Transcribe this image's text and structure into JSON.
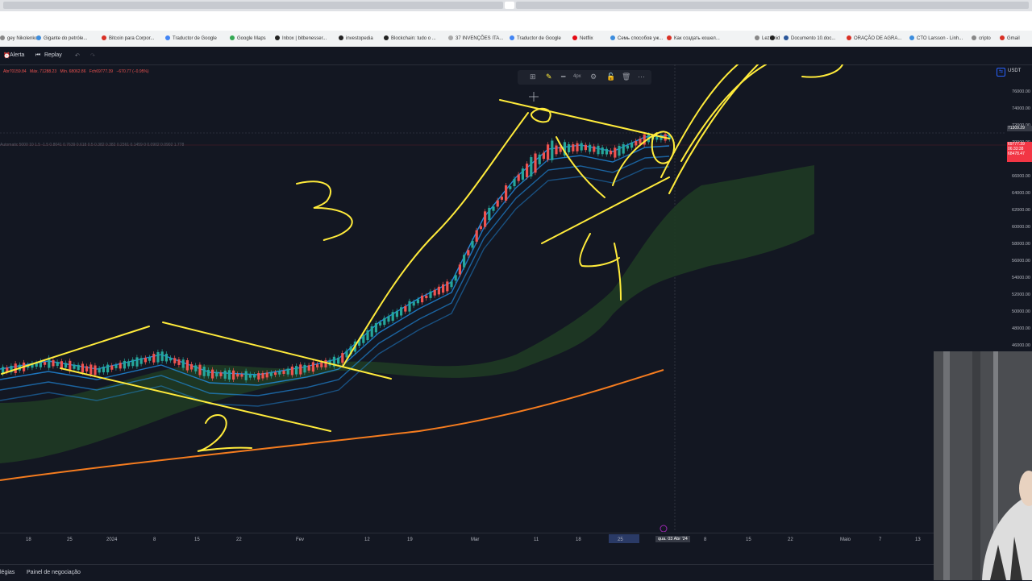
{
  "browser": {
    "bookmarks": [
      {
        "label": "gey Nikolenko",
        "color": "#888"
      },
      {
        "label": "Gigante do petróle...",
        "color": "#3c8dde"
      },
      {
        "label": "Bitcoin para Corpor...",
        "color": "#d93025"
      },
      {
        "label": "Traductor de Google",
        "color": "#4285f4"
      },
      {
        "label": "Google Maps",
        "color": "#34a853"
      },
      {
        "label": "Inbox | bitbenesser...",
        "color": "#222"
      },
      {
        "label": "investopedia",
        "color": "#222"
      },
      {
        "label": "Blockchain: tudo o ...",
        "color": "#222"
      },
      {
        "label": "37 INVENÇÕES ITA...",
        "color": "#aaa"
      },
      {
        "label": "Traductor de Google",
        "color": "#4285f4"
      },
      {
        "label": "Netflix",
        "color": "#e50914"
      },
      {
        "label": "Семь способов уж...",
        "color": "#3c8dde"
      },
      {
        "label": "Как создать кошел...",
        "color": "#d93025"
      },
      {
        "label": "Lezioni",
        "color": "#888"
      },
      {
        "label": "d",
        "color": "#222"
      },
      {
        "label": "Documento 10.doc...",
        "color": "#2b579a"
      },
      {
        "label": "ORAÇÃO DE AGRA...",
        "color": "#d93025"
      },
      {
        "label": "CTO Larsson - Linh...",
        "color": "#3c8dde"
      },
      {
        "label": "cripto",
        "color": "#888"
      },
      {
        "label": "Gmail",
        "color": "#d93025"
      }
    ]
  },
  "toolbar": {
    "alert_label": "Alerta",
    "replay_label": "Replay",
    "undo_icon": "undo-icon",
    "redo_icon": "redo-icon"
  },
  "legend": {
    "open": "Abr70159.84",
    "high": "Máx. 71288.23",
    "low": "Mín. 68062.86",
    "close": "Fch69777.39",
    "change": "−670.77 (−0.95%)",
    "fib_text": "Automatic 5000 10 1.5 -1.5 0.8041 0.7639 0.618 0.5 0.382 0.382 0.2361 0.1459 0 0.0902 0.0902 1.778"
  },
  "drawing_toolbar": {
    "items": [
      "template-icon",
      "pencil-icon",
      "line-style-icon",
      "settings-icon",
      "lock-icon",
      "trash-icon",
      "more-icon"
    ],
    "width_label": "4px"
  },
  "price_axis": {
    "currency": "USDT",
    "labels": [
      "76000.00",
      "74000.00",
      "72000.00",
      "70000.00",
      "68000.00",
      "66000.00",
      "64000.00",
      "62000.00",
      "60000.00",
      "58000.00",
      "56000.00",
      "54000.00",
      "52000.00",
      "50000.00",
      "48000.00",
      "46000.00"
    ],
    "crosshair_price": "71309.29",
    "last_price": "69777.39",
    "countdown": "06:33:38",
    "second_price": "68478.47"
  },
  "time_axis": {
    "labels": [
      "18",
      "25",
      "2024",
      "8",
      "15",
      "22",
      "Fev",
      "12",
      "19",
      "Mar",
      "11",
      "18",
      "25",
      "8",
      "15",
      "22",
      "Maio",
      "7",
      "13"
    ],
    "crosshair_date": "qua. 03 Abr '24"
  },
  "annotations": {
    "numbers": [
      "3",
      "2",
      "4"
    ]
  },
  "bottom_bar": {
    "tab1": "légias",
    "tab2": "Painel de negociação"
  },
  "colors": {
    "bg": "#131722",
    "up": "#26a69a",
    "down": "#ef5350",
    "drawing": "#ffeb3b",
    "ema_long": "#f57c1f",
    "band": "#2196f3",
    "cloud": "#1f3a24"
  }
}
